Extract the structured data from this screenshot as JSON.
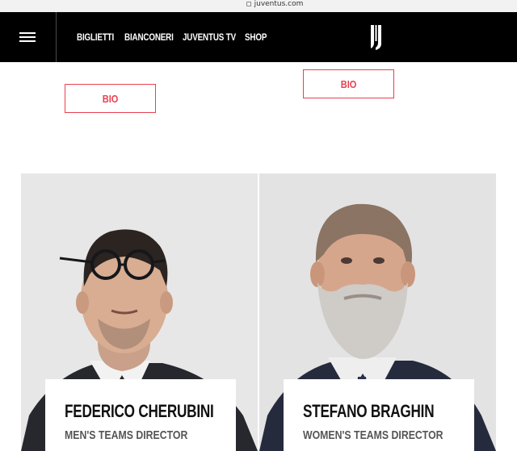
{
  "browser": {
    "url": "juventus.com"
  },
  "nav": {
    "links": [
      "BIGLIETTI",
      "BIANCONERI",
      "JUVENTUS TV",
      "SHOP"
    ]
  },
  "bio_buttons": [
    "BIO",
    "BIO"
  ],
  "people": [
    {
      "name": "FEDERICO CHERUBINI",
      "role": "MEN'S TEAMS DIRECTOR"
    },
    {
      "name": "STEFANO BRAGHIN",
      "role": "WOMEN'S TEAMS DIRECTOR"
    }
  ],
  "colors": {
    "nav_bg": "#000000",
    "accent": "#e8414f",
    "photo_bg": "#e6e6e6"
  },
  "icons": {
    "menu": "hamburger-menu-icon",
    "logo": "juventus-logo",
    "lock": "lock-icon"
  }
}
